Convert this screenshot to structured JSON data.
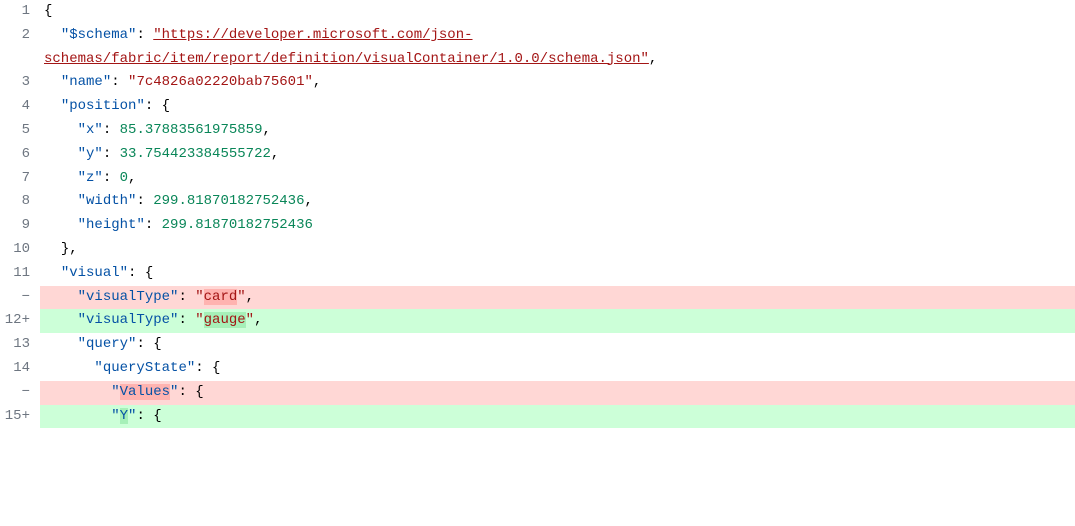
{
  "gutter": [
    "1",
    "2",
    "3",
    "4",
    "5",
    "6",
    "7",
    "8",
    "9",
    "10",
    "11",
    "−",
    "12+",
    "13",
    "14",
    "−",
    "15+"
  ],
  "multiLineIdx": 1,
  "tokens": {
    "schema": "$schema",
    "schemaUrl": "https://developer.microsoft.com/json-schemas/fabric/item/report/definition/visualContainer/1.0.0/schema.json",
    "name": "name",
    "nameVal": "7c4826a02220bab75601",
    "position": "position",
    "x": "x",
    "xv": "85.37883561975859",
    "y": "y",
    "yv": "33.754423384555722",
    "z": "z",
    "zv": "0",
    "width": "width",
    "wv": "299.81870182752436",
    "height": "height",
    "hv": "299.81870182752436",
    "visual": "visual",
    "visualType": "visualType",
    "card": "card",
    "gauge": "gauge",
    "query": "query",
    "queryState": "queryState",
    "Values": "Values",
    "Y": "Y"
  }
}
